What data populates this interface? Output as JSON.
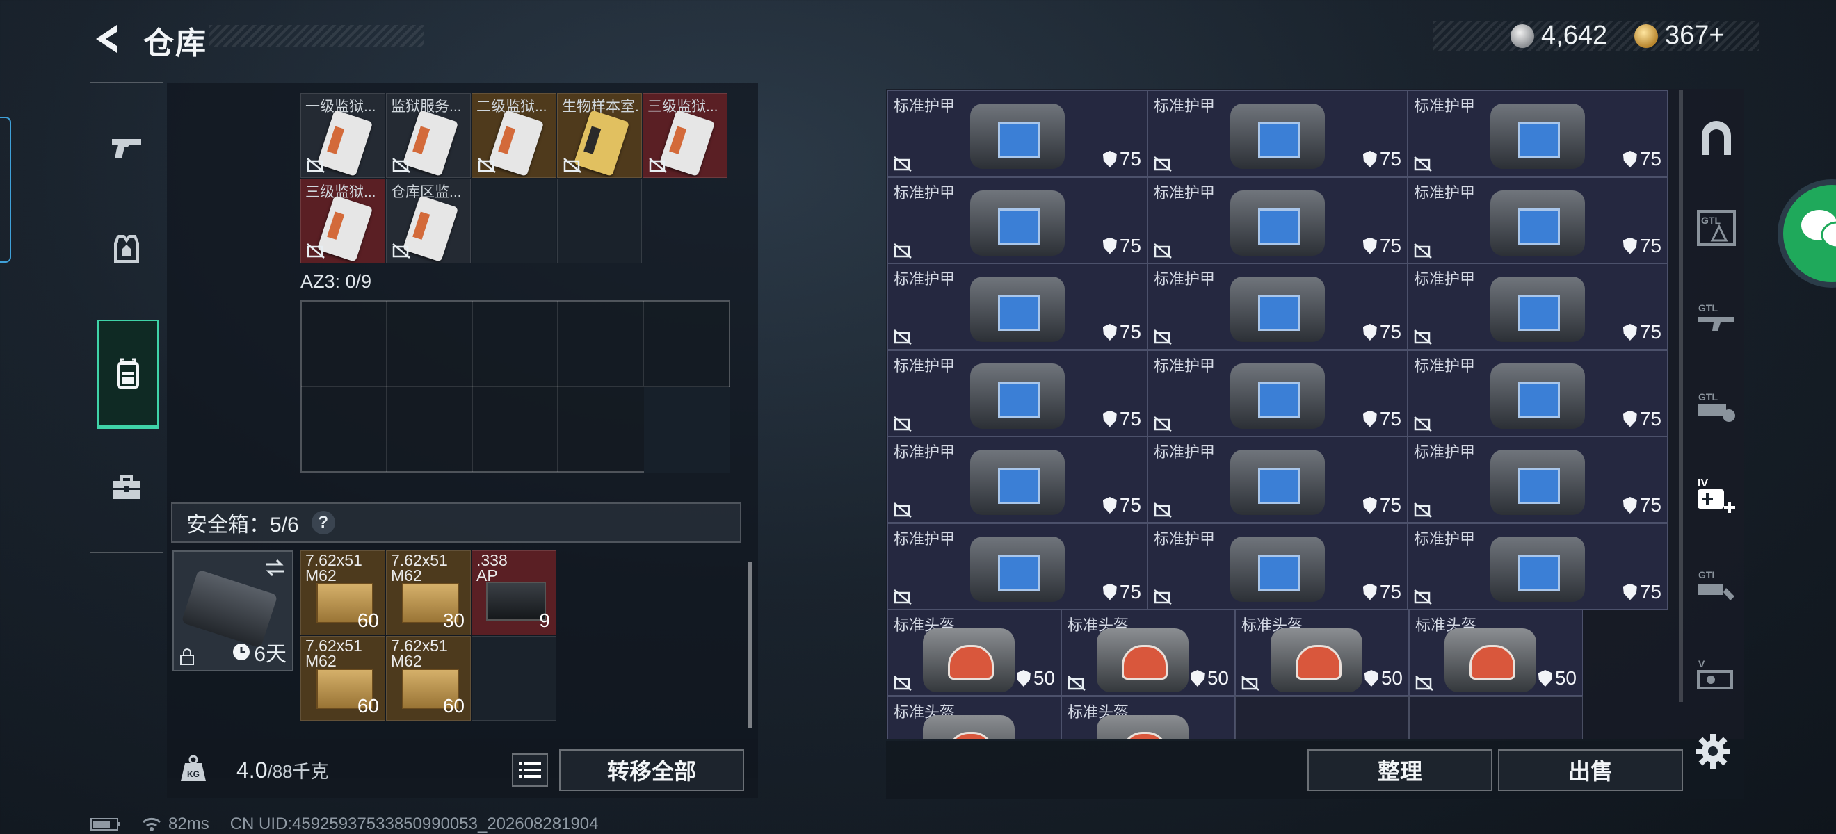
{
  "header": {
    "title": "仓库"
  },
  "currency": {
    "silver": "4,642",
    "gold": "367+"
  },
  "left_nav": [
    {
      "name": "weapon"
    },
    {
      "name": "armor"
    },
    {
      "name": "backpack"
    },
    {
      "name": "case"
    }
  ],
  "key_cards": [
    {
      "label": "一级监狱...",
      "style": "dark"
    },
    {
      "label": "监狱服务...",
      "style": "dark"
    },
    {
      "label": "二级监狱...",
      "style": "gold"
    },
    {
      "label": "生物样本室...",
      "style": "gold"
    },
    {
      "label": "三级监狱...",
      "style": "red"
    },
    {
      "label": "三级监狱...",
      "style": "red"
    },
    {
      "label": "仓库区监...",
      "style": "dark"
    }
  ],
  "az3_label": "AZ3: 0/9",
  "safe_box": {
    "title": "安全箱：5/6",
    "help": "?",
    "days_left": "6天"
  },
  "safe_items": [
    {
      "line1": "7.62x51",
      "line2": "M62",
      "count": "60",
      "style": "ammo"
    },
    {
      "line1": "7.62x51",
      "line2": "M62",
      "count": "30",
      "style": "ammo"
    },
    {
      "line1": ".338",
      "line2": "AP",
      "count": "9",
      "style": "red"
    },
    {
      "line1": "7.62x51",
      "line2": "M62",
      "count": "60",
      "style": "ammo"
    },
    {
      "line1": "7.62x51",
      "line2": "M62",
      "count": "60",
      "style": "ammo"
    }
  ],
  "weight": {
    "current": "4.0",
    "max": "/88千克"
  },
  "buttons": {
    "transfer_all": "转移全部",
    "organize": "整理",
    "sell": "出售"
  },
  "storage": {
    "armor_name": "标准护甲",
    "armor_durability": "75",
    "armor_count": 18,
    "helmet_name": "标准头盔",
    "helmet_durability": "50",
    "helmet_count": 6
  },
  "right_rail": [
    "vault-icon",
    "gtl-armor-icon",
    "gtl-rifle-icon",
    "gtl-grenade-icon",
    "iv-medkit-icon",
    "gti-misc-icon",
    "v-key-icon"
  ],
  "status_bar": {
    "ping": "82ms",
    "uid": "CN UID:459259375338509900​53_202608281904"
  }
}
